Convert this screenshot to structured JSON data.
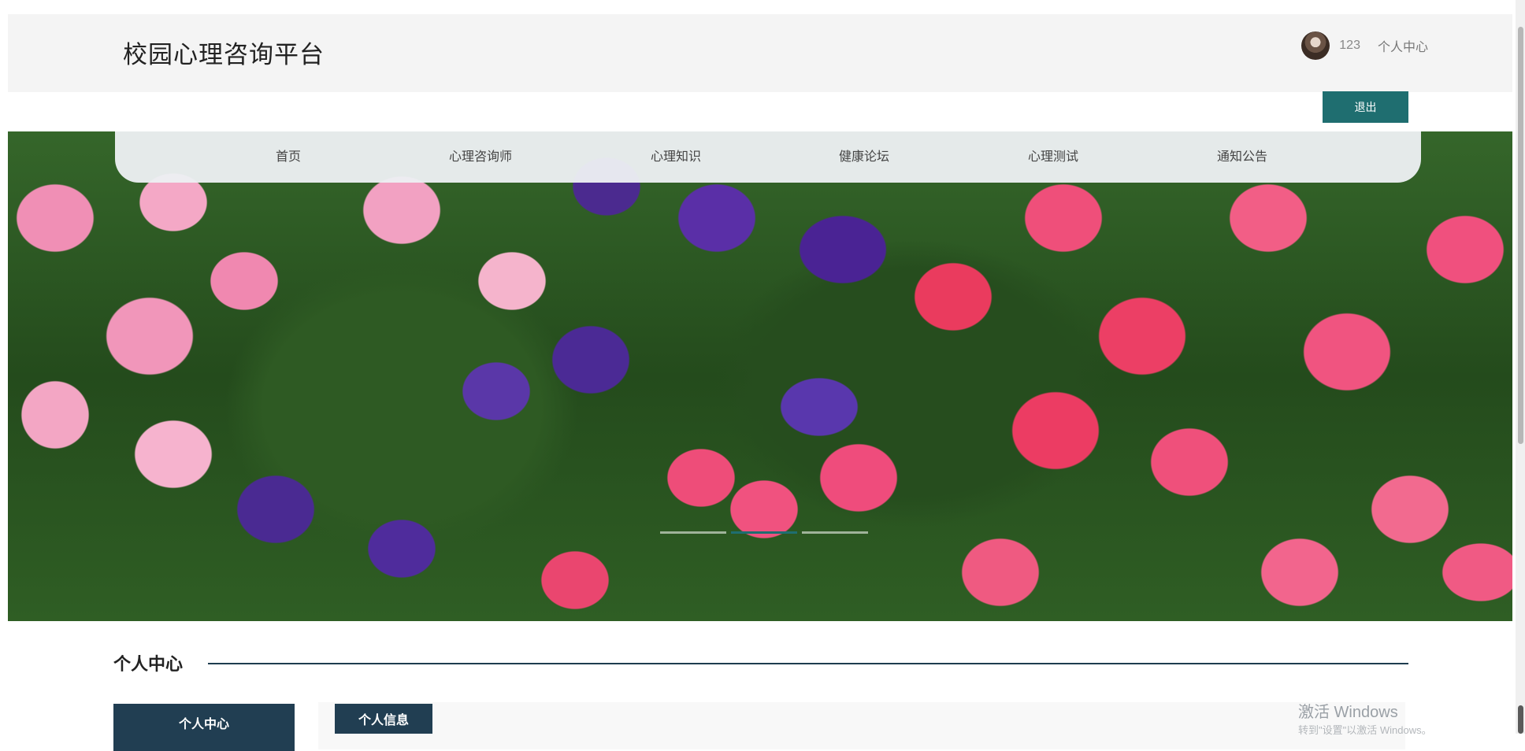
{
  "header": {
    "site_title": "校园心理咨询平台",
    "username": "123",
    "user_center_label": "个人中心",
    "logout_label": "退出"
  },
  "nav": {
    "items": [
      {
        "label": "首页"
      },
      {
        "label": "心理咨询师"
      },
      {
        "label": "心理知识"
      },
      {
        "label": "健康论坛"
      },
      {
        "label": "心理测试"
      },
      {
        "label": "通知公告"
      }
    ]
  },
  "carousel": {
    "slide_count": 3,
    "active_index": 1
  },
  "section": {
    "title": "个人中心"
  },
  "sidebar": {
    "active_item": "个人中心"
  },
  "content": {
    "tab_label": "个人信息"
  },
  "watermark": {
    "title": "激活 Windows",
    "subtitle": "转到\"设置\"以激活 Windows。"
  },
  "colors": {
    "accent_teal": "#1f6e70",
    "dark_navy": "#213e52"
  }
}
